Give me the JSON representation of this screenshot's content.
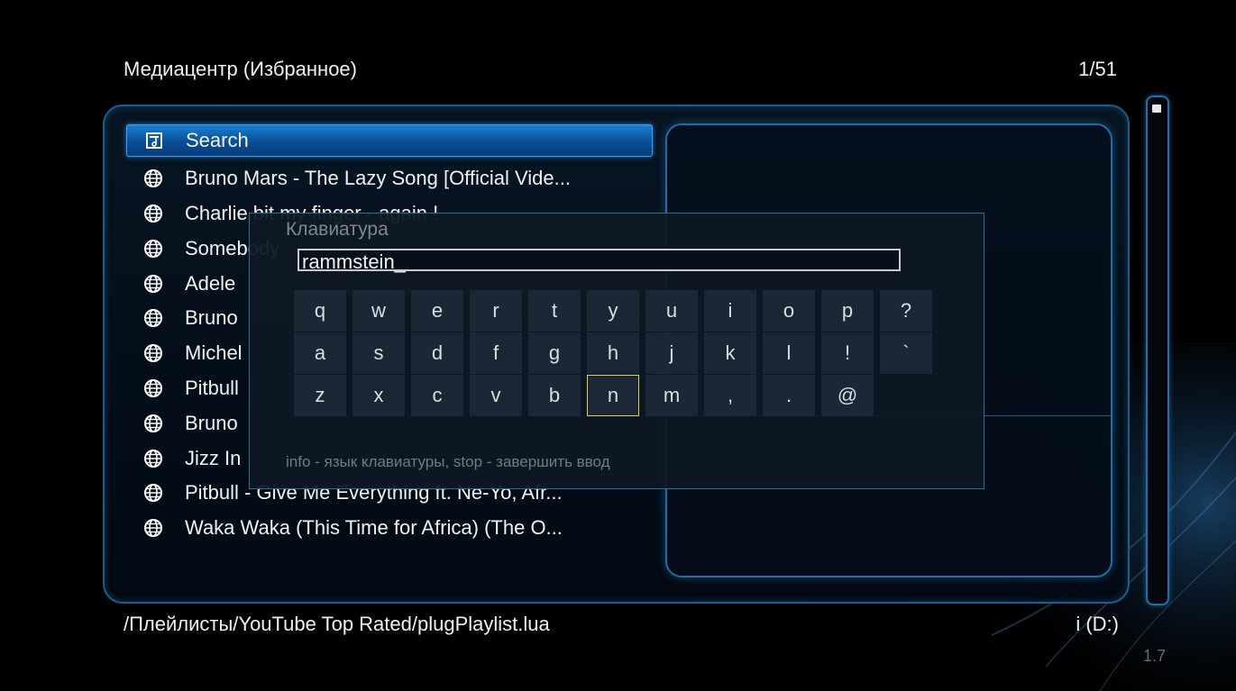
{
  "header": {
    "title": "Медиацентр (Избранное)",
    "page_counter": "1/51"
  },
  "list": {
    "items": [
      {
        "label": "Search",
        "icon": "playlist-icon",
        "selected": true
      },
      {
        "label": "Bruno Mars - The Lazy Song [Official Vide...",
        "icon": "globe-icon"
      },
      {
        "label": "Charlie bit my finger - again !",
        "icon": "globe-icon"
      },
      {
        "label": "Somebody",
        "icon": "globe-icon"
      },
      {
        "label": "Adele",
        "icon": "globe-icon"
      },
      {
        "label": "Bruno",
        "icon": "globe-icon"
      },
      {
        "label": "Michel",
        "icon": "globe-icon"
      },
      {
        "label": "Pitbull",
        "icon": "globe-icon"
      },
      {
        "label": "Bruno",
        "icon": "globe-icon"
      },
      {
        "label": "Jizz In",
        "icon": "globe-icon"
      },
      {
        "label": "Pitbull - Give Me Everything ft. Ne-Yo, Afr...",
        "icon": "globe-icon"
      },
      {
        "label": "Waka Waka (This Time for Africa) (The O...",
        "icon": "globe-icon"
      }
    ]
  },
  "keyboard": {
    "title": "Клавиатура",
    "input_value": "rammstein_",
    "rows": [
      [
        "q",
        "w",
        "e",
        "r",
        "t",
        "y",
        "u",
        "i",
        "o",
        "p",
        "?"
      ],
      [
        "a",
        "s",
        "d",
        "f",
        "g",
        "h",
        "j",
        "k",
        "l",
        "!",
        "`"
      ],
      [
        "z",
        "x",
        "c",
        "v",
        "b",
        "n",
        "m",
        ",",
        ".",
        "@"
      ]
    ],
    "focused_key": "n",
    "hint": "info - язык клавиатуры, stop - завершить ввод"
  },
  "footer": {
    "path": "/Плейлисты/YouTube Top Rated/plugPlaylist.lua",
    "drive": "i (D:)",
    "version": "1.7"
  },
  "colors": {
    "accent": "#1f6fa8",
    "selection": "#0a4e95",
    "focus": "#e3cd4a"
  }
}
